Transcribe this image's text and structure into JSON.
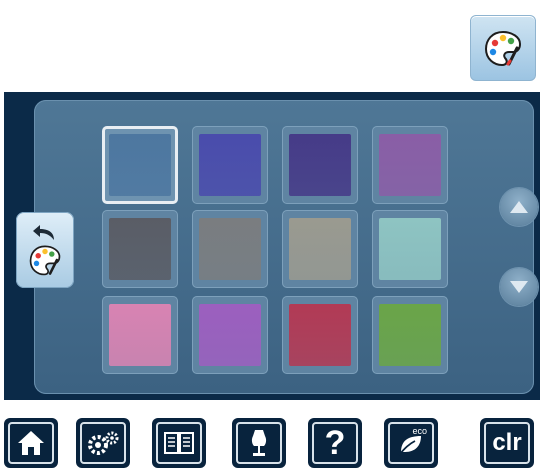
{
  "header": {
    "palette_button_icon": "color-palette-icon"
  },
  "colors": {
    "screen_bg": "#0b2a48",
    "panel": "#4a7291",
    "toolbar_button": "#08233d"
  },
  "swatches": [
    [
      "#4d77a0",
      "#4a4cac",
      "#463b88",
      "#8a5ea6"
    ],
    [
      "#5a5d66",
      "#7a7d80",
      "#9a9a90",
      "#8ec4c2"
    ],
    [
      "#d883b2",
      "#9c5fbf",
      "#b23a55",
      "#6aa548"
    ]
  ],
  "selected_swatch": {
    "row": 0,
    "col": 0
  },
  "side_tab": {
    "icons": [
      "back-arrow-icon",
      "color-palette-icon"
    ]
  },
  "scroll": {
    "up_icon": "triangle-up-icon",
    "down_icon": "triangle-down-icon"
  },
  "toolbar": {
    "buttons": [
      {
        "icon": "home-icon"
      },
      {
        "icon": "gears-icon"
      },
      {
        "icon": "book-icon"
      },
      {
        "icon": "dress-form-icon"
      },
      {
        "icon": "help-icon",
        "label": "?"
      },
      {
        "icon": "eco-leaf-icon",
        "label": "eco"
      },
      {
        "icon": "clear-icon",
        "label": "clr"
      }
    ]
  }
}
